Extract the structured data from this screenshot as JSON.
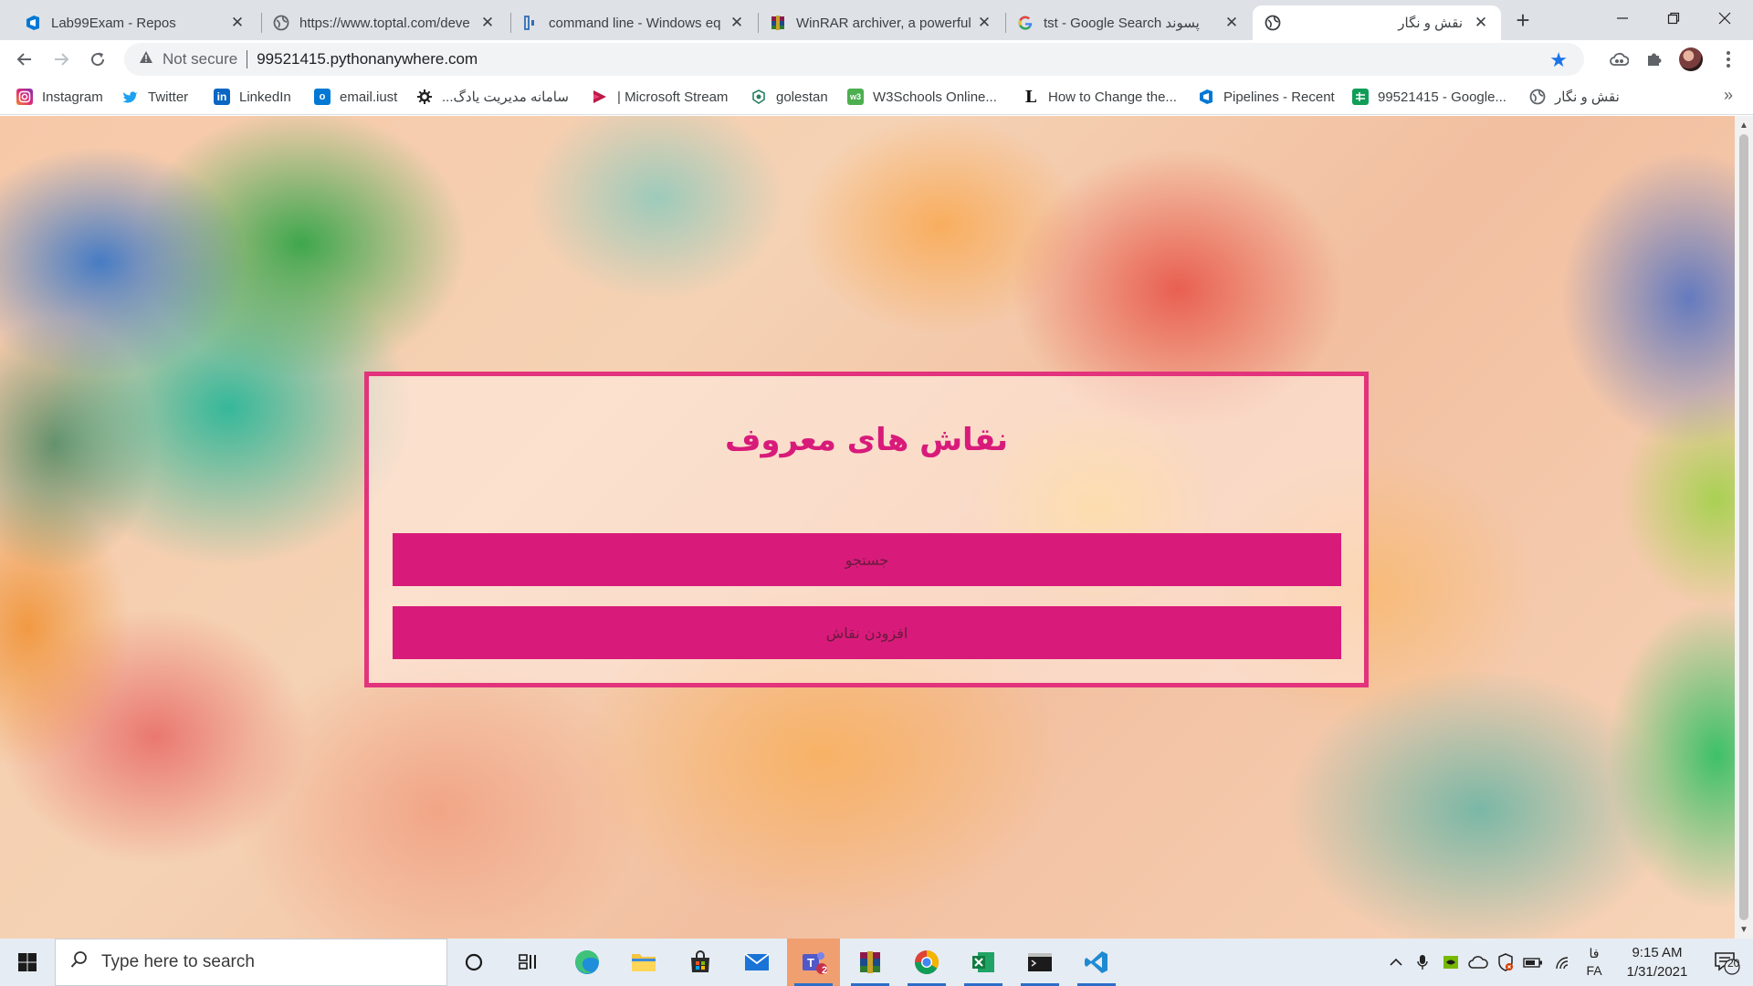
{
  "browser": {
    "tabs": [
      {
        "title": "Lab99Exam - Repos",
        "icon": "azure-devops-icon",
        "active": false
      },
      {
        "title": "https://www.toptal.com/deve",
        "icon": "globe-icon",
        "active": false
      },
      {
        "title": "command line - Windows eq",
        "icon": "superuser-icon",
        "active": false
      },
      {
        "title": "WinRAR archiver, a powerful",
        "icon": "winrar-icon",
        "active": false
      },
      {
        "title": "tst - Google Search پسوند",
        "icon": "google-icon",
        "active": false
      },
      {
        "title": "نقش و نگار",
        "icon": "globe-icon",
        "active": true
      }
    ],
    "new_tab_label": "+",
    "window_controls": {
      "minimize": "—",
      "maximize": "❐",
      "close": "✕"
    },
    "address": {
      "security_label": "Not secure",
      "url": "99521415.pythonanywhere.com"
    },
    "bookmarks": [
      {
        "label": "Instagram",
        "icon": "instagram-icon",
        "color": "#d6249f"
      },
      {
        "label": "Twitter",
        "icon": "twitter-icon",
        "color": "#1da1f2"
      },
      {
        "label": "LinkedIn",
        "icon": "linkedin-icon",
        "color": "#0a66c2"
      },
      {
        "label": "email.iust",
        "icon": "outlook-icon",
        "color": "#0078d4"
      },
      {
        "label": "سامانه مدیریت یادگ...",
        "icon": "gear-icon",
        "color": "#222222"
      },
      {
        "label": "| Microsoft Stream",
        "icon": "stream-icon",
        "color": "#bc1948"
      },
      {
        "label": "golestan",
        "icon": "golestan-icon",
        "color": "#2a7f62"
      },
      {
        "label": "W3Schools Online...",
        "icon": "w3schools-icon",
        "color": "#4caf50"
      },
      {
        "label": "How to Change the...",
        "icon": "l-icon",
        "color": "#111111"
      },
      {
        "label": "Pipelines - Recent",
        "icon": "azure-devops-icon",
        "color": "#0078d4"
      },
      {
        "label": "99521415 - Google...",
        "icon": "google-sheets-icon",
        "color": "#0f9d58"
      },
      {
        "label": "نقش و نگار",
        "icon": "globe-icon",
        "color": "#5f6368"
      }
    ],
    "bookmarks_more": "»"
  },
  "page": {
    "title": "نقاش های معروف",
    "buttons": {
      "search": "جستجو",
      "add_painter": "افزودن نقاش"
    },
    "accent_color": "#d81b7a"
  },
  "taskbar": {
    "search_placeholder": "Type here to search",
    "apps": [
      {
        "name": "cortana",
        "icon": "cortana-icon"
      },
      {
        "name": "task-view",
        "icon": "task-view-icon"
      },
      {
        "name": "edge",
        "icon": "edge-icon"
      },
      {
        "name": "file-explorer",
        "icon": "folder-icon"
      },
      {
        "name": "store",
        "icon": "store-icon"
      },
      {
        "name": "mail",
        "icon": "mail-icon"
      },
      {
        "name": "teams",
        "icon": "teams-icon",
        "badge": "2"
      },
      {
        "name": "winrar",
        "icon": "winrar-icon"
      },
      {
        "name": "chrome",
        "icon": "chrome-icon"
      },
      {
        "name": "excel",
        "icon": "excel-icon"
      },
      {
        "name": "terminal",
        "icon": "terminal-icon"
      },
      {
        "name": "vscode",
        "icon": "vscode-icon"
      }
    ],
    "language_top": "فا",
    "language_bottom": "FA",
    "time": "9:15 AM",
    "date": "1/31/2021",
    "notification_count": "20"
  }
}
